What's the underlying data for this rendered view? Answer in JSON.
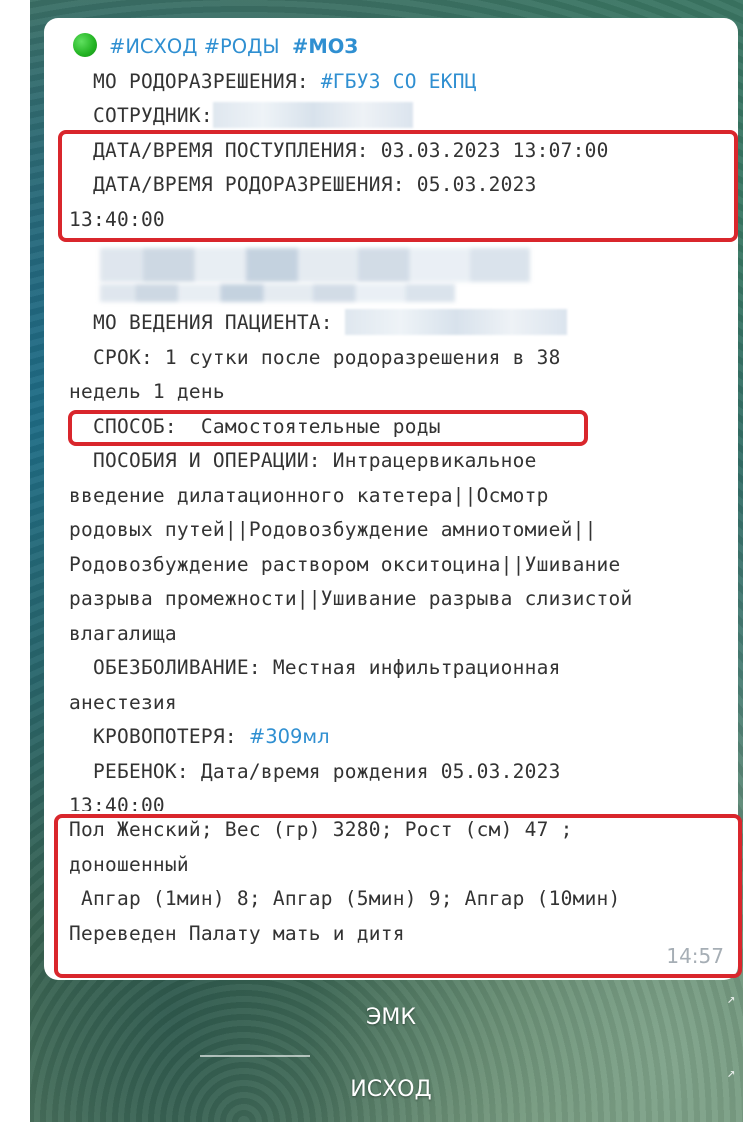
{
  "message": {
    "tags": [
      "#ИСХОД",
      "#РОДЫ",
      "#МОЗ"
    ],
    "mo_label": "МО РОДОРАЗРЕШЕНИЯ:",
    "mo_tag": "#ГБУЗ СО ЕКПЦ",
    "employee_label": "СОТРУДНИК:",
    "admission_line": "ДАТА/ВРЕМЯ ПОСТУПЛЕНИЯ: 03.03.2023 13:07:00",
    "delivery_line_1": "ДАТА/ВРЕМЯ РОДОРАЗРЕШЕНИЯ: 05.03.2023",
    "delivery_line_2": "13:40:00",
    "patient_mo_label": "МО ВЕДЕНИЯ ПАЦИЕНТА:",
    "term_line_1": "СРОК: 1 сутки после родоразрешения в 38",
    "term_line_2": "недель 1 день",
    "method_line": "СПОСОБ:  Самостоятельные роды",
    "ops_line_1": "ПОСОБИЯ И ОПЕРАЦИИ: Интрацервикальное",
    "ops_line_2": "введение дилатационного катетера||Осмотр",
    "ops_line_3": "родовых путей||Родовозбуждение амниотомией||",
    "ops_line_4": "Родовозбуждение раствором окситоцина||Ушивание",
    "ops_line_5": "разрыва промежности||Ушивание разрыва слизистой",
    "ops_line_6": "влагалища",
    "anesthesia_line_1": "ОБЕЗБОЛИВАНИЕ: Местная инфильтрационная",
    "anesthesia_line_2": "анестезия",
    "blood_loss_label": "КРОВОПОТЕРЯ:",
    "blood_loss_tag": "#309мл",
    "child_line_1": "РЕБЕНОК: Дата/время рождения 05.03.2023",
    "child_line_2": "13:40:00",
    "child_line_3": "Пол Женский; Вес (гр) 3280; Рост (см) 47 ;",
    "child_line_4": "доношенный",
    "child_line_5": " Апгар (1мин) 8; Апгар (5мин) 9; Апгар (10мин)",
    "child_line_6": "Переведен Палату мать и дитя",
    "time": "14:57"
  },
  "keyboard": {
    "buttons": [
      "ЭМК",
      "ИСХОД"
    ]
  },
  "colors": {
    "tag": "#2f8fd1",
    "highlight": "#d9262c",
    "status_dot": "#22b322"
  }
}
